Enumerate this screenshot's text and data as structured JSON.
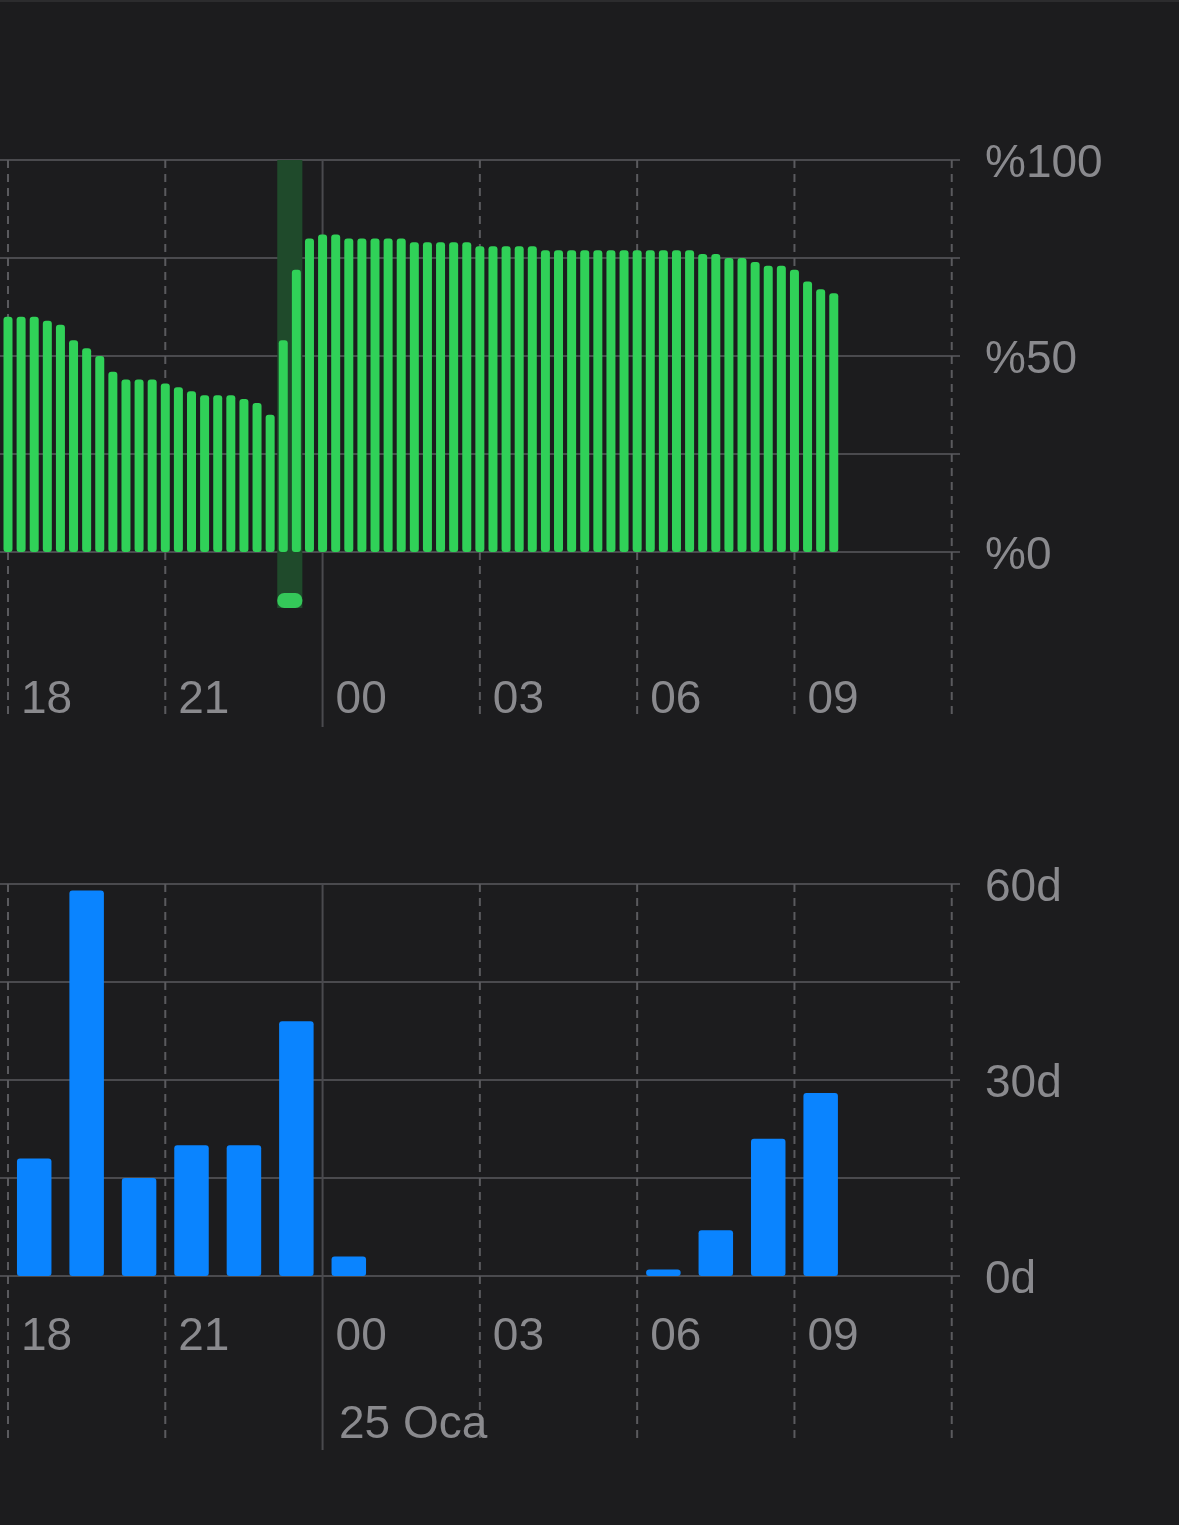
{
  "battery_chart": {
    "chart_data": {
      "type": "bar",
      "categories": [
        null,
        null,
        null,
        null,
        null,
        null,
        null,
        null,
        null,
        null,
        null,
        null,
        null,
        null,
        null,
        null,
        null,
        null,
        null,
        null,
        null,
        null,
        null,
        null,
        null,
        null,
        null,
        null,
        null,
        null,
        null,
        null,
        null,
        null,
        null,
        null,
        null,
        null,
        null,
        null,
        null,
        null,
        null,
        null,
        null,
        null,
        null,
        null,
        null,
        null,
        null,
        null,
        null,
        null,
        null,
        null,
        null,
        null,
        null,
        null,
        null,
        null,
        null,
        null
      ],
      "series": [
        {
          "color": "#30d158",
          "values": [
            60,
            60,
            60,
            59,
            58,
            54,
            52,
            50,
            46,
            44,
            44,
            44,
            43,
            42,
            41,
            40,
            40,
            40,
            39,
            38,
            35,
            54,
            72,
            80,
            81,
            81,
            80,
            80,
            80,
            80,
            80,
            79,
            79,
            79,
            79,
            79,
            78,
            78,
            78,
            78,
            78,
            77,
            77,
            77,
            77,
            77,
            77,
            77,
            77,
            77,
            77,
            77,
            77,
            76,
            76,
            75,
            75,
            74,
            73,
            73,
            72,
            69,
            67,
            66
          ]
        }
      ],
      "ylim": [
        0,
        100
      ],
      "yticks": [
        {
          "value": 100,
          "label": "%100"
        },
        {
          "value": 50,
          "label": "%50"
        },
        {
          "value": 0,
          "label": "%0"
        }
      ],
      "grid": true
    },
    "charging_slots": [
      false,
      false,
      false,
      false,
      false,
      false,
      false,
      false,
      false,
      false,
      false,
      false,
      false,
      false,
      false,
      false,
      false,
      false,
      false,
      false,
      false,
      true,
      true,
      false,
      false,
      false,
      false,
      false,
      false,
      false,
      false,
      false,
      false,
      false,
      false,
      false,
      false,
      false,
      false,
      false,
      false,
      false,
      false,
      false,
      false,
      false,
      false,
      false,
      false,
      false,
      false,
      false,
      false,
      false,
      false,
      false,
      false,
      false,
      false,
      false,
      false,
      false,
      false,
      false
    ],
    "time_labels": [
      "18",
      "21",
      "00",
      "03",
      "06",
      "09"
    ]
  },
  "activity_chart": {
    "chart_data": {
      "type": "bar",
      "categories": [
        null,
        null,
        null,
        null,
        null,
        null,
        null,
        null,
        null,
        null,
        null,
        null,
        null,
        null,
        null,
        null,
        null,
        null
      ],
      "series": [
        {
          "color": "#0a84ff",
          "values": [
            18,
            59,
            15,
            20,
            20,
            39,
            3,
            0,
            0,
            0,
            0,
            0,
            1,
            7,
            21,
            28,
            null,
            null
          ]
        }
      ],
      "ylim": [
        0,
        60
      ],
      "yticks": [
        {
          "value": 60,
          "label": "60d"
        },
        {
          "value": 30,
          "label": "30d"
        },
        {
          "value": 0,
          "label": "0d"
        }
      ],
      "grid": true
    },
    "time_labels": [
      "18",
      "21",
      "00",
      "03",
      "06",
      "09"
    ],
    "date_label": "25 Oca"
  }
}
